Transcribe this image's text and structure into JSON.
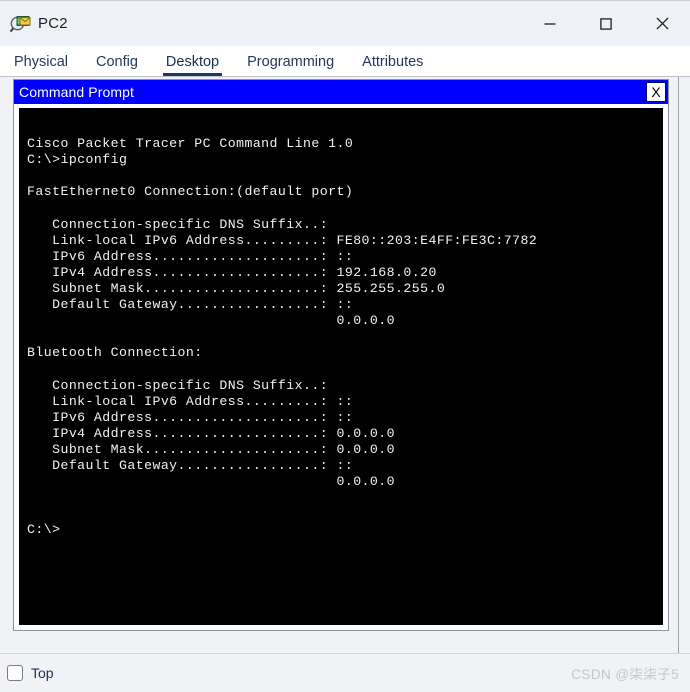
{
  "window": {
    "title": "PC2",
    "icon": "inspect-magnifier-icon",
    "controls": {
      "minimize_label": "—",
      "maximize_label": "□",
      "close_label": "✕"
    }
  },
  "tabs": [
    {
      "label": "Physical",
      "active": false
    },
    {
      "label": "Config",
      "active": false
    },
    {
      "label": "Desktop",
      "active": true
    },
    {
      "label": "Programming",
      "active": false
    },
    {
      "label": "Attributes",
      "active": false
    }
  ],
  "cli_window": {
    "title": "Command Prompt",
    "close_label": "X",
    "title_bar_color": "#0000ff",
    "title_text_color": "#ffffff",
    "terminal_bg": "#000000",
    "terminal_fg": "#f2f2f2",
    "terminal_lines": [
      "",
      "Cisco Packet Tracer PC Command Line 1.0",
      "C:\\>ipconfig",
      "",
      "FastEthernet0 Connection:(default port)",
      "",
      "   Connection-specific DNS Suffix..:",
      "   Link-local IPv6 Address.........: FE80::203:E4FF:FE3C:7782",
      "   IPv6 Address....................: ::",
      "   IPv4 Address....................: 192.168.0.20",
      "   Subnet Mask.....................: 255.255.255.0",
      "   Default Gateway.................: ::",
      "                                     0.0.0.0",
      "",
      "Bluetooth Connection:",
      "",
      "   Connection-specific DNS Suffix..:",
      "   Link-local IPv6 Address.........: ::",
      "   IPv6 Address....................: ::",
      "   IPv4 Address....................: 0.0.0.0",
      "   Subnet Mask.....................: 0.0.0.0",
      "   Default Gateway.................: ::",
      "                                     0.0.0.0",
      "",
      "",
      "C:\\>"
    ]
  },
  "status_bar": {
    "top_checkbox_label": "Top",
    "top_checkbox_checked": false,
    "watermark": "CSDN @柒柒子5"
  }
}
